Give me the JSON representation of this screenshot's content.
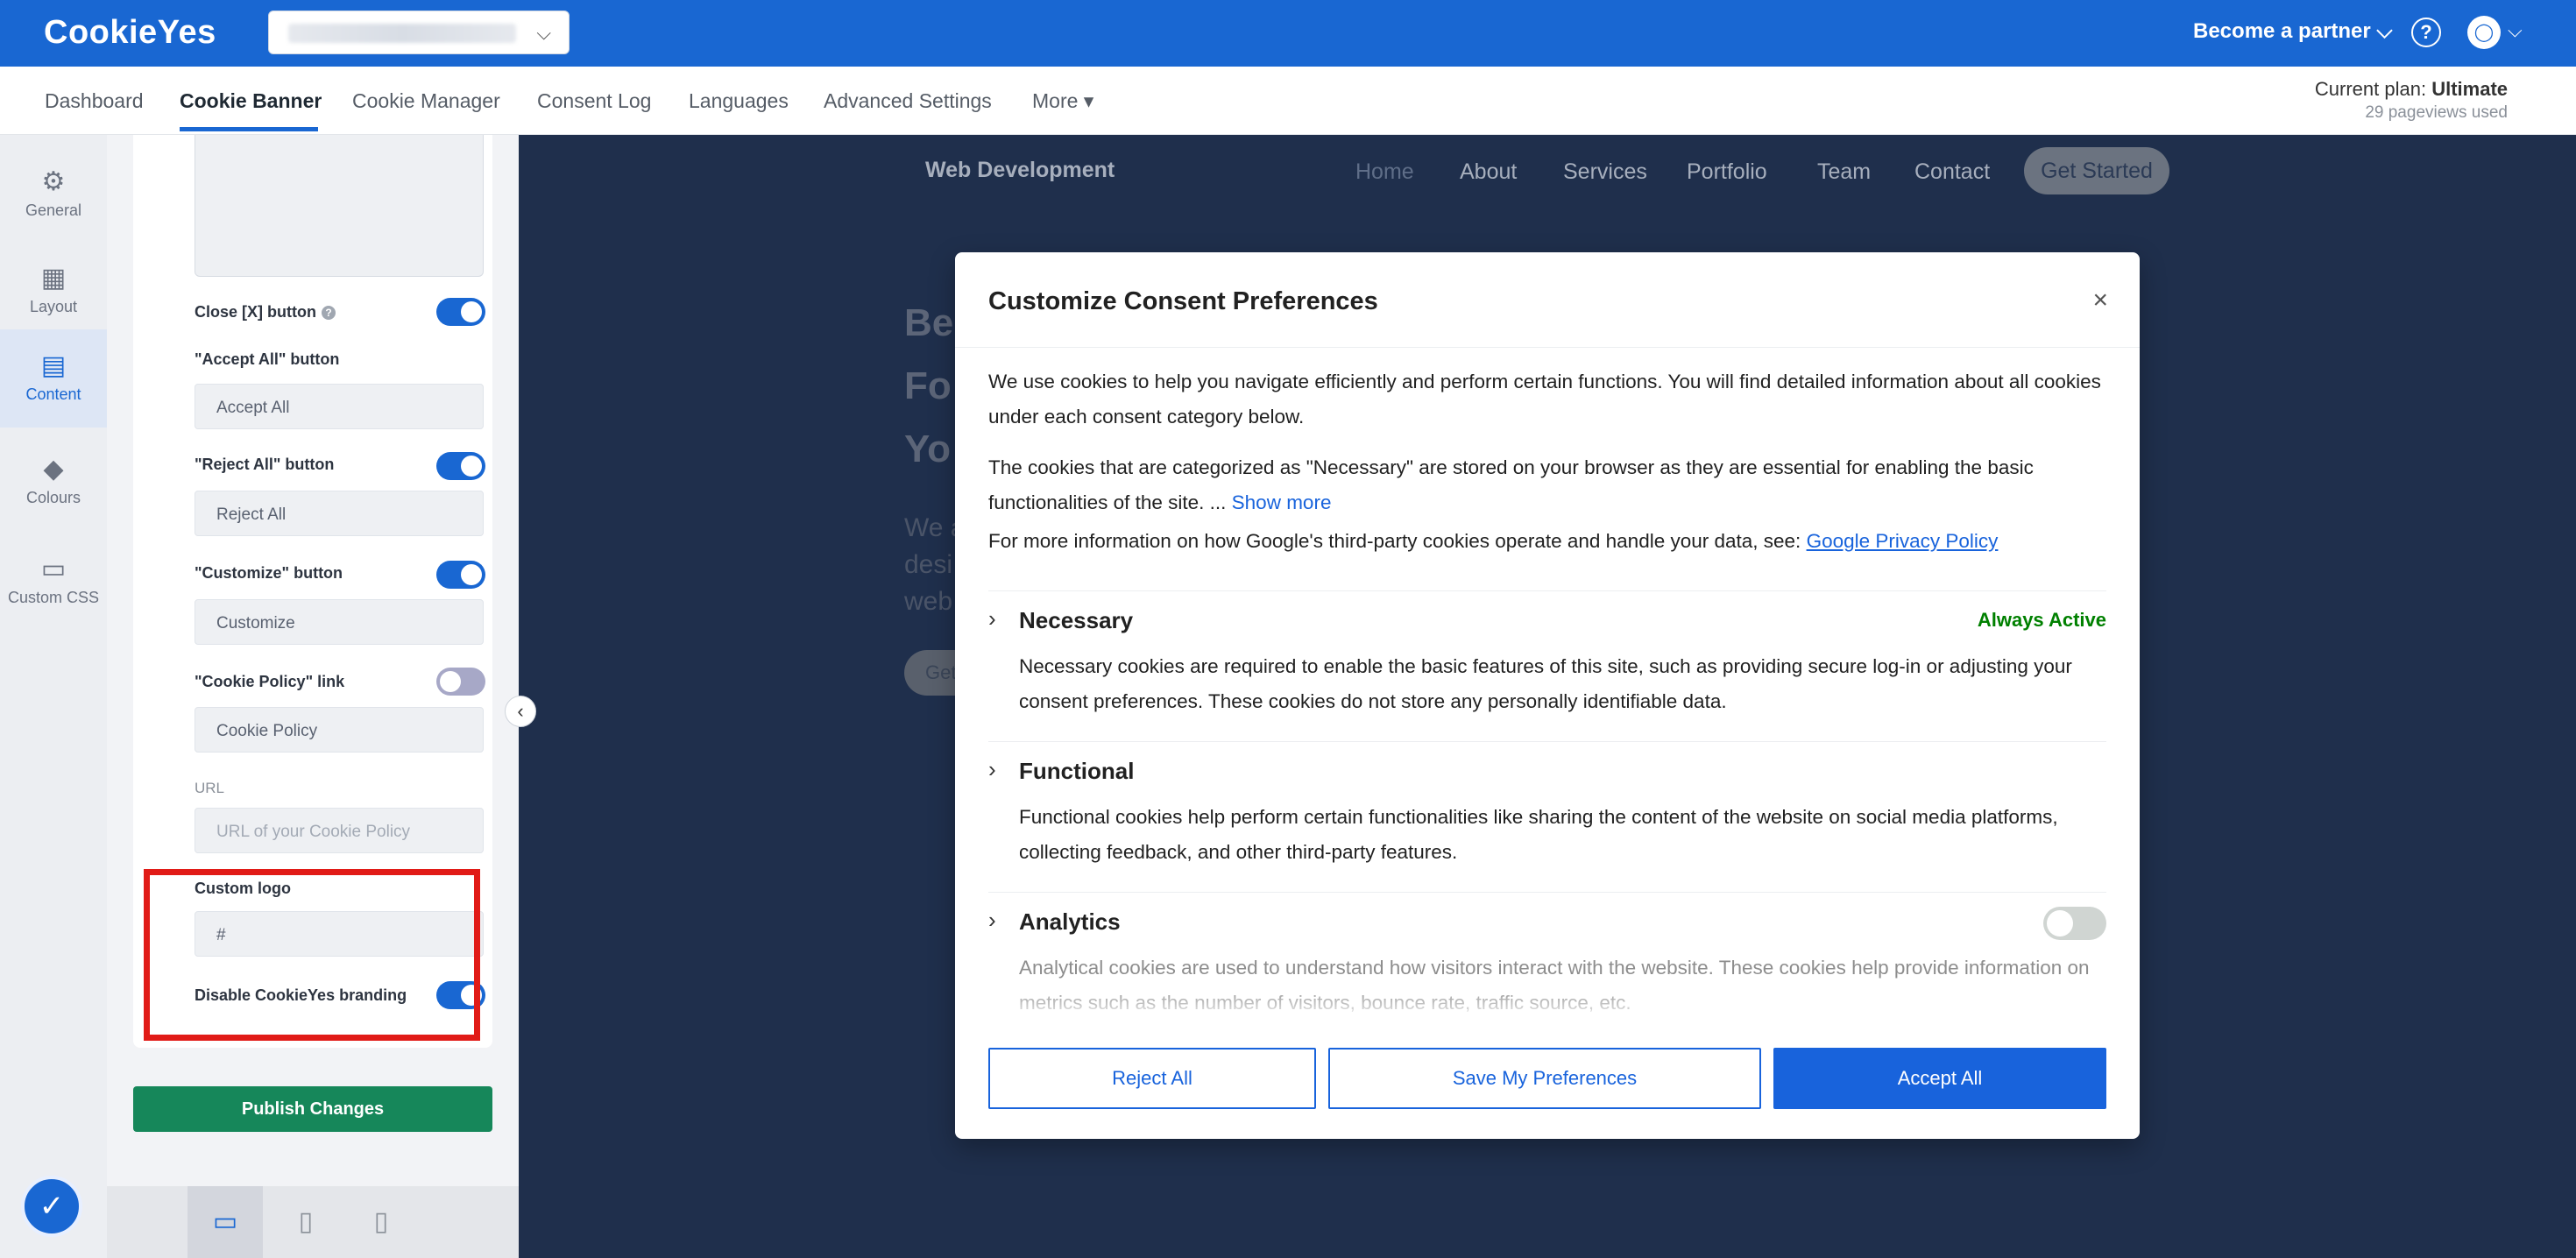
{
  "topbar": {
    "logo": "CookieYes",
    "site_select_chevron": "⌵",
    "partner": "Become a partner ⌵",
    "help": "?",
    "avatar": "◯",
    "avatar_chevron": "⌵"
  },
  "nav": {
    "items": [
      "Dashboard",
      "Cookie Banner",
      "Cookie Manager",
      "Consent Log",
      "Languages",
      "Advanced Settings",
      "More ▾"
    ],
    "plan_label": "Current plan: ",
    "plan_value": "Ultimate",
    "pageviews": "29 pageviews used"
  },
  "rail": {
    "items": [
      {
        "label": "General",
        "icon": "gear-icon"
      },
      {
        "label": "Layout",
        "icon": "layout-icon"
      },
      {
        "label": "Content",
        "icon": "document-icon"
      },
      {
        "label": "Colours",
        "icon": "paint-bucket-icon"
      },
      {
        "label": "Custom CSS",
        "icon": "css-file-icon"
      }
    ]
  },
  "panel": {
    "close_button_label": "Close [X] button",
    "accept_all_label": "\"Accept All\" button",
    "accept_all_value": "Accept All",
    "reject_all_label": "\"Reject All\" button",
    "reject_all_value": "Reject All",
    "customize_label": "\"Customize\" button",
    "customize_value": "Customize",
    "cookie_policy_label": "\"Cookie Policy\" link",
    "cookie_policy_value": "Cookie Policy",
    "url_label": "URL",
    "url_placeholder": "URL of your Cookie Policy",
    "custom_logo_label": "Custom logo",
    "custom_logo_value": "#",
    "disable_branding_label": "Disable CookieYes branding",
    "publish": "Publish Changes"
  },
  "toggles": {
    "close_button": true,
    "reject_all": true,
    "customize": true,
    "cookie_policy": false,
    "disable_branding": true
  },
  "site": {
    "brand": "Web Development",
    "nav": [
      "Home",
      "About",
      "Services",
      "Portfolio",
      "Team",
      "Contact"
    ],
    "cta": "Get Started",
    "hero_lines": [
      "Be",
      "Fo",
      "Yo"
    ],
    "hero_sub": [
      "We a",
      "desi",
      "web"
    ],
    "hero_btn": "Get"
  },
  "modal": {
    "title": "Customize Consent Preferences",
    "close": "×",
    "intro": "We use cookies to help you navigate efficiently and perform certain functions. You will find detailed information about all cookies under each consent category below.",
    "necessary_note": "The cookies that are categorized as \"Necessary\" are stored on your browser as they are essential for enabling the basic functionalities of the site. ... ",
    "show_more": "Show more",
    "google_note": "For more information on how Google's third-party cookies operate and handle your data, see: ",
    "google_link": "Google Privacy Policy",
    "categories": [
      {
        "title": "Necessary",
        "status": "Always Active",
        "desc": "Necessary cookies are required to enable the basic features of this site, such as providing secure log-in or adjusting your consent preferences. These cookies do not store any personally identifiable data."
      },
      {
        "title": "Functional",
        "desc": "Functional cookies help perform certain functionalities like sharing the content of the website on social media platforms, collecting feedback, and other third-party features."
      },
      {
        "title": "Analytics",
        "desc": "Analytical cookies are used to understand how visitors interact with the website. These cookies help provide information on metrics such as the number of visitors, bounce rate, traffic source, etc."
      }
    ],
    "analytics_enabled": false,
    "buttons": {
      "reject": "Reject All",
      "save": "Save My Preferences",
      "accept": "Accept All"
    }
  },
  "colors": {
    "brand_blue": "#1967d2",
    "publish_green": "#16875a",
    "always_active_green": "#008000",
    "highlight_red": "#e11b17"
  }
}
